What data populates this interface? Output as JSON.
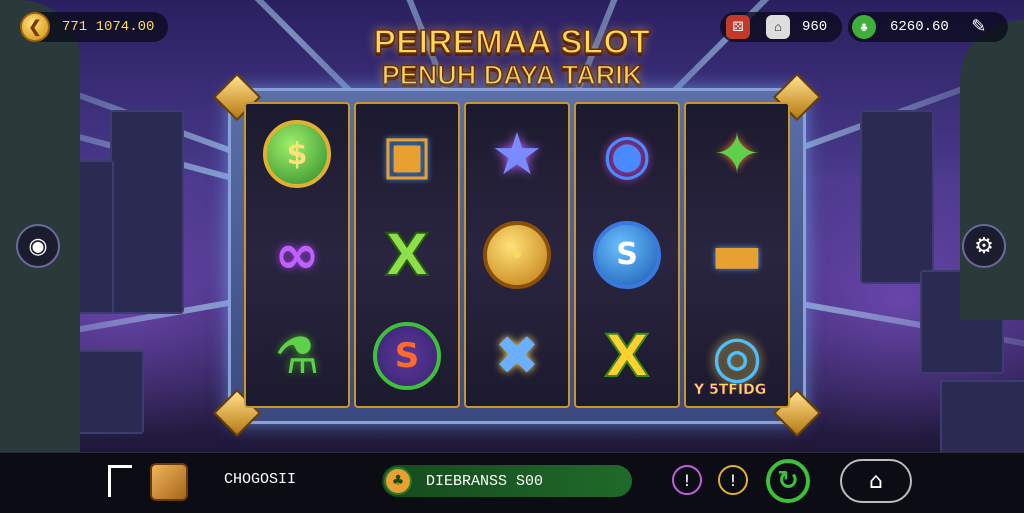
{
  "title": {
    "line1": "PEIREMAA SLOT",
    "line2": "PENUH DAYA TARIK"
  },
  "topbar": {
    "balance": "771 1074.00",
    "gems_value": "960",
    "bonus_value": "6260.60",
    "icons": [
      "gold-coin-icon",
      "dice-icon",
      "house-icon",
      "clover-icon",
      "tool-icon"
    ]
  },
  "reels": [
    [
      {
        "icon": "dollar-coin-icon",
        "glyph": "$"
      },
      {
        "icon": "chain-link-icon",
        "glyph": "∞"
      },
      {
        "icon": "potion-bottle-icon",
        "glyph": "⚗"
      }
    ],
    [
      {
        "icon": "treasure-chest-icon",
        "glyph": "▣"
      },
      {
        "icon": "green-x-icon",
        "glyph": "X"
      },
      {
        "icon": "dollar-shield-icon",
        "glyph": "S"
      }
    ],
    [
      {
        "icon": "crystal-star-icon",
        "glyph": "★"
      },
      {
        "icon": "gold-coin-icon",
        "glyph": "●"
      },
      {
        "icon": "crystal-x-icon",
        "glyph": "✖"
      }
    ],
    [
      {
        "icon": "ring-ticket-icon",
        "glyph": "◉"
      },
      {
        "icon": "blue-s-coin-icon",
        "glyph": "S"
      },
      {
        "icon": "yellow-x-icon",
        "glyph": "X"
      }
    ],
    [
      {
        "icon": "green-dragon-icon",
        "glyph": "✦"
      },
      {
        "icon": "cannon-bullet-icon",
        "glyph": "▬"
      },
      {
        "icon": "wild-ring-icon",
        "glyph": "◎"
      }
    ]
  ],
  "reel_label": "Y 5TFIDG",
  "bottom": {
    "bet_value": "CHOGOSII",
    "win_label": "DIEBRANSS S00"
  },
  "colors": {
    "accent": "#ffd95a",
    "frame": "#8aa0d8",
    "win_bar": "#1f6a2a"
  }
}
